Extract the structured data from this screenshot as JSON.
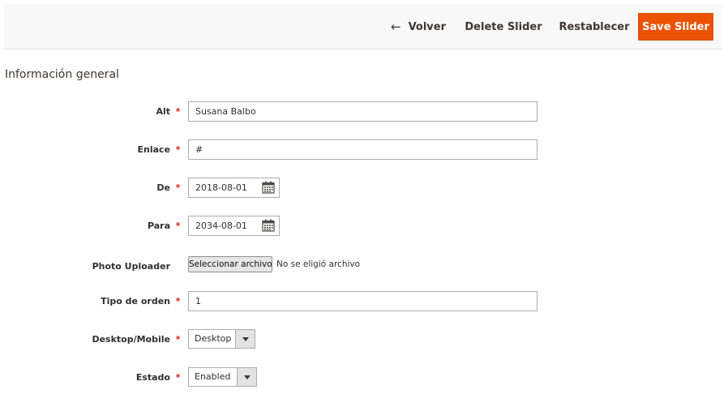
{
  "toolbar": {
    "back_label": "Volver",
    "delete_label": "Delete Slider",
    "reset_label": "Restablecer",
    "save_label": "Save Slider"
  },
  "section": {
    "title": "Información general"
  },
  "fields": {
    "alt": {
      "label": "Alt",
      "value": "Susana Balbo",
      "required": true
    },
    "enlace": {
      "label": "Enlace",
      "value": "#",
      "required": true
    },
    "de": {
      "label": "De",
      "value": "2018-08-01",
      "required": true
    },
    "para": {
      "label": "Para",
      "value": "2034-08-01",
      "required": true
    },
    "photo": {
      "label": "Photo Uploader",
      "button_label": "Seleccionar archivo",
      "status": "No se eligió archivo"
    },
    "tipo_orden": {
      "label": "Tipo de orden",
      "value": "1",
      "required": true
    },
    "device": {
      "label": "Desktop/Mobile",
      "value": "Desktop",
      "required": true
    },
    "estado": {
      "label": "Estado",
      "value": "Enabled",
      "required": true
    }
  },
  "required_mark": "*",
  "colors": {
    "accent": "#eb5202",
    "required": "#e22626",
    "toolbar_bg": "#f8f8f8"
  }
}
